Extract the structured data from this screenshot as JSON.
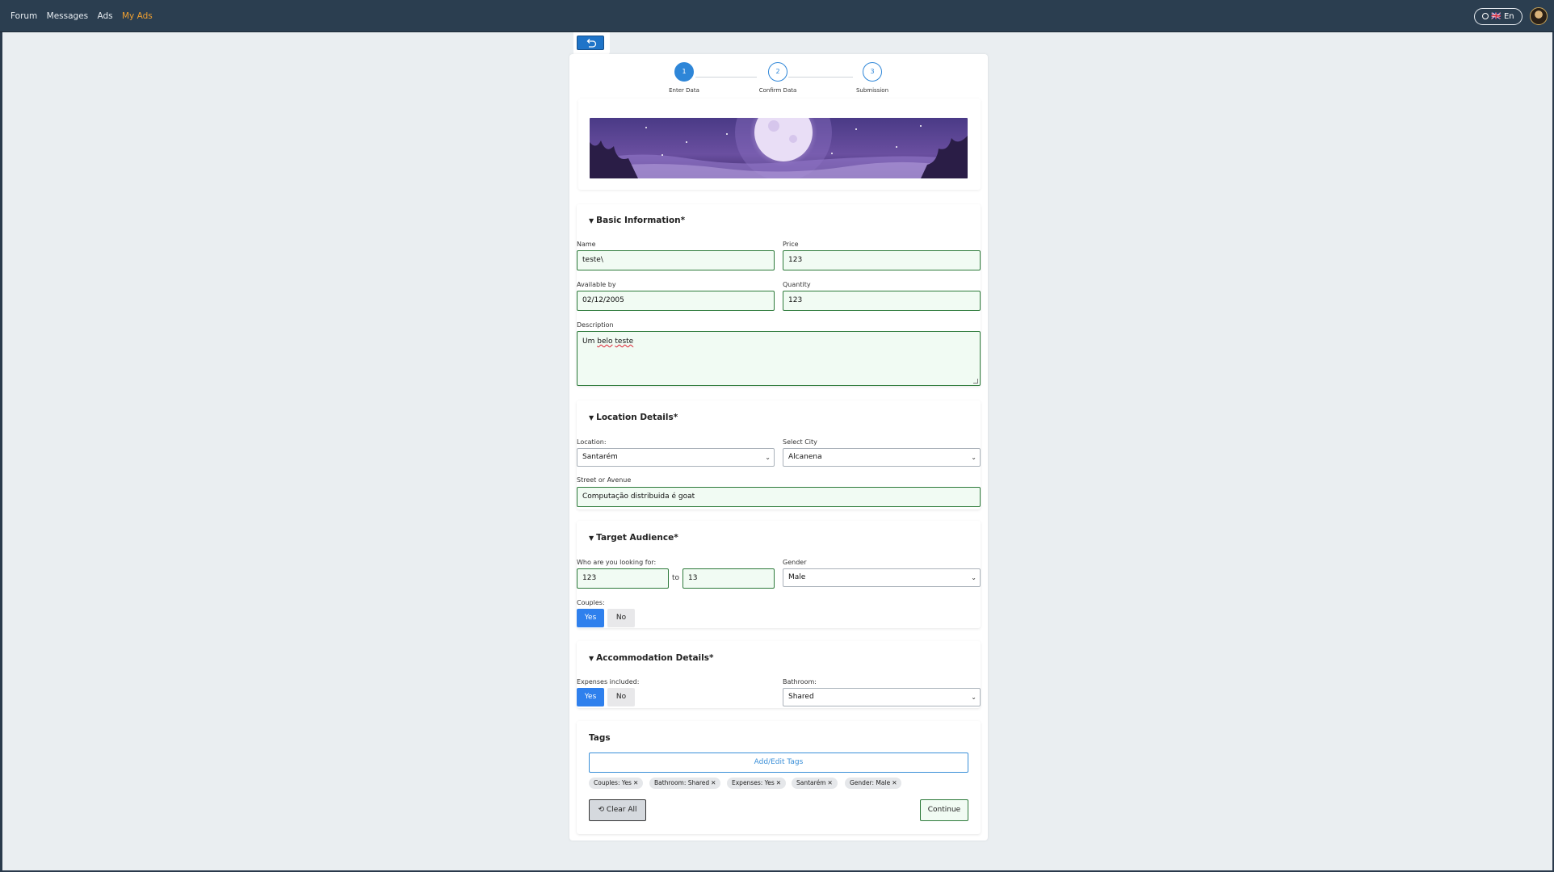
{
  "nav": {
    "links": [
      "Forum",
      "Messages",
      "Ads",
      "My Ads"
    ],
    "active": "My Ads",
    "language": "🇬🇧 En"
  },
  "stepper": {
    "steps": [
      {
        "number": "1",
        "label": "Enter Data",
        "state": "active"
      },
      {
        "number": "2",
        "label": "Confirm Data",
        "state": "pending"
      },
      {
        "number": "3",
        "label": "Submission",
        "state": "pending"
      }
    ]
  },
  "basic_info": {
    "title": "Basic Information*",
    "name_label": "Name",
    "name_value": "teste\\",
    "price_label": "Price",
    "price_value": "123",
    "available_label": "Available by",
    "available_value": "02/12/2005",
    "quantity_label": "Quantity",
    "quantity_value": "123",
    "description_label": "Description",
    "description_value": {
      "word1": "Um",
      "word2": "belo",
      "word3": "teste"
    }
  },
  "location": {
    "title": "Location Details*",
    "location_label": "Location:",
    "location_value": "Santarém",
    "city_label": "Select City",
    "city_value": "Alcanena",
    "street_label": "Street or Avenue",
    "street_value": "Computação distribuida é goat"
  },
  "audience": {
    "title": "Target Audience*",
    "looking_label": "Who are you looking for:",
    "age_from": "123",
    "to_label": "to",
    "age_to": "13",
    "gender_label": "Gender",
    "gender_value": "Male",
    "couples_label": "Couples:",
    "yes_label": "Yes",
    "no_label": "No",
    "couples_selected": "Yes"
  },
  "accommodation": {
    "title": "Accommodation Details*",
    "expenses_label": "Expenses included:",
    "yes_label": "Yes",
    "no_label": "No",
    "expenses_selected": "Yes",
    "bathroom_label": "Bathroom:",
    "bathroom_value": "Shared"
  },
  "tags": {
    "title": "Tags",
    "edit_button": "Add/Edit Tags",
    "chips": [
      "Couples: Yes",
      "Bathroom: Shared",
      "Expenses: Yes",
      "Santarém",
      "Gender: Male"
    ],
    "clear_all": "Clear All",
    "continue": "Continue"
  }
}
